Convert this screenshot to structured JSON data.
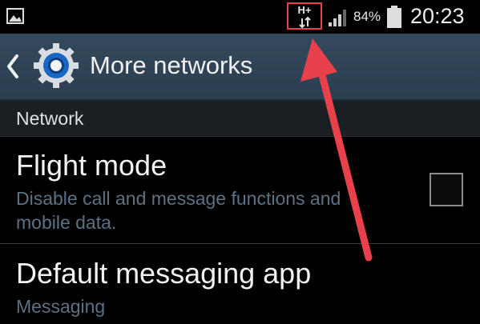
{
  "status_bar": {
    "network_type": "H+",
    "battery_percent": "84%",
    "time": "20:23"
  },
  "action_bar": {
    "title": "More networks"
  },
  "section": {
    "label": "Network"
  },
  "items": [
    {
      "title": "Flight mode",
      "summary_line1": "Disable call and message functions and",
      "summary_line2": "mobile data.",
      "checked": false
    },
    {
      "title": "Default messaging app",
      "summary": "Messaging"
    }
  ],
  "colors": {
    "action_bar": "#2f4356",
    "summary_text": "#5c7283",
    "annotation": "#e8414b"
  }
}
